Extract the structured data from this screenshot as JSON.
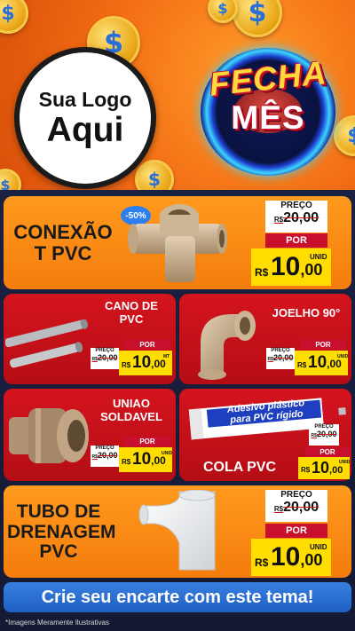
{
  "header": {
    "logo_line1": "Sua Logo",
    "logo_line2": "Aqui",
    "campaign_line1": "FECHA",
    "campaign_line2": "MÊS",
    "coin_symbol": "$"
  },
  "products": [
    {
      "name_line1": "CONEXÃO",
      "name_line2": "T PVC",
      "discount": "-50%",
      "preco_label": "PREÇO",
      "old_currency": "R$",
      "old_price": "20,00",
      "por_label": "POR",
      "currency": "R$",
      "price_int": "10",
      "price_dec": ",00",
      "unit": "UNID"
    },
    {
      "name_line1": "CANO DE",
      "name_line2": "PVC",
      "preco_label": "PREÇO",
      "old_currency": "R$",
      "old_price": "20,00",
      "por_label": "POR",
      "currency": "R$",
      "price_int": "10",
      "price_dec": ",00",
      "unit": "MT"
    },
    {
      "name_line1": "JOELHO 90°",
      "preco_label": "PREÇO",
      "old_currency": "R$",
      "old_price": "20,00",
      "por_label": "POR",
      "currency": "R$",
      "price_int": "10",
      "price_dec": ",00",
      "unit": "UNID"
    },
    {
      "name_line1": "UNIAO",
      "name_line2": "SOLDAVEL",
      "preco_label": "PREÇO",
      "old_currency": "R$",
      "old_price": "20,00",
      "por_label": "POR",
      "currency": "R$",
      "price_int": "10",
      "price_dec": ",00",
      "unit": "UNID"
    },
    {
      "name_line1": "COLA PVC",
      "tube_text1": "Adesivo plástico",
      "tube_text2": "para PVC rígido",
      "preco_label": "PREÇO",
      "old_currency": "R$",
      "old_price": "20,00",
      "por_label": "POR",
      "currency": "R$",
      "price_int": "10",
      "price_dec": ",00",
      "unit": "UNID"
    },
    {
      "name_line1": "TUBO DE",
      "name_line2": "DRENAGEM",
      "name_line3": "PVC",
      "preco_label": "PREÇO",
      "old_currency": "R$",
      "old_price": "20,00",
      "por_label": "POR",
      "currency": "R$",
      "price_int": "10",
      "price_dec": ",00",
      "unit": "UNID"
    }
  ],
  "cta": "Crie seu encarte com este tema!",
  "disclaimer": "*Imagens Meramente Ilustrativas",
  "colors": {
    "orange": "#f47c0c",
    "red": "#c8102e",
    "yellow": "#ffdd00",
    "blue": "#2d6fd8"
  }
}
